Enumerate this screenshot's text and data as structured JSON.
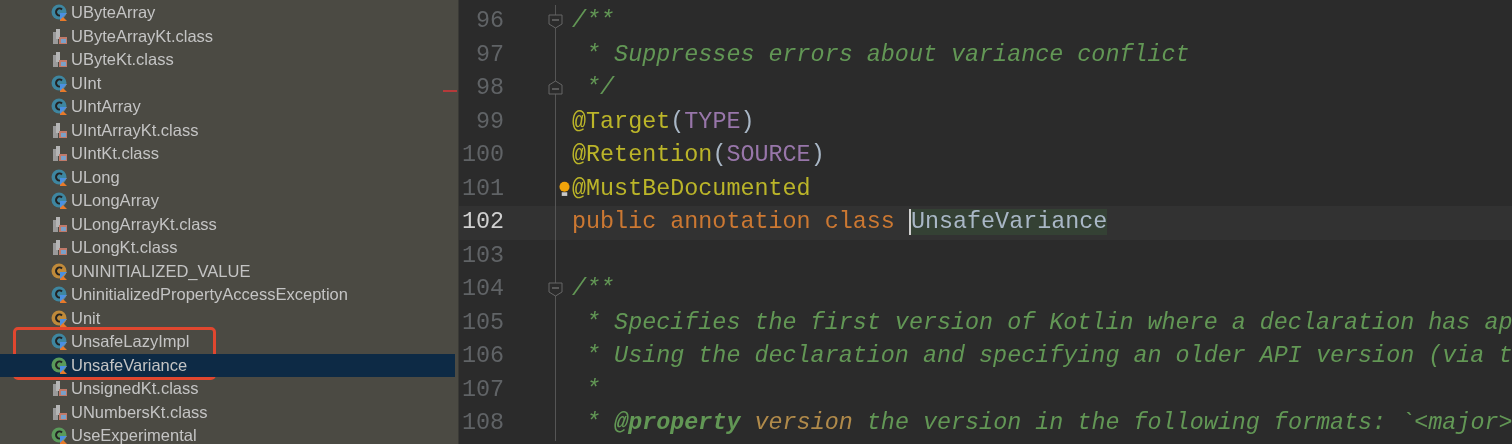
{
  "project_tree": {
    "items": [
      {
        "label": "UByteArray",
        "kind": "class",
        "selected": false,
        "annotated": false
      },
      {
        "label": "UByteArrayKt.class",
        "kind": "file",
        "selected": false,
        "annotated": false
      },
      {
        "label": "UByteKt.class",
        "kind": "file",
        "selected": false,
        "annotated": false
      },
      {
        "label": "UInt",
        "kind": "class",
        "selected": false,
        "annotated": false
      },
      {
        "label": "UIntArray",
        "kind": "class",
        "selected": false,
        "annotated": false
      },
      {
        "label": "UIntArrayKt.class",
        "kind": "file",
        "selected": false,
        "annotated": false
      },
      {
        "label": "UIntKt.class",
        "kind": "file",
        "selected": false,
        "annotated": false
      },
      {
        "label": "ULong",
        "kind": "class",
        "selected": false,
        "annotated": false
      },
      {
        "label": "ULongArray",
        "kind": "class",
        "selected": false,
        "annotated": false
      },
      {
        "label": "ULongArrayKt.class",
        "kind": "file",
        "selected": false,
        "annotated": false
      },
      {
        "label": "ULongKt.class",
        "kind": "file",
        "selected": false,
        "annotated": false
      },
      {
        "label": "UNINITIALIZED_VALUE",
        "kind": "object",
        "selected": false,
        "annotated": false
      },
      {
        "label": "UninitializedPropertyAccessException",
        "kind": "class",
        "selected": false,
        "annotated": false
      },
      {
        "label": "Unit",
        "kind": "object",
        "selected": false,
        "annotated": false
      },
      {
        "label": "UnsafeLazyImpl",
        "kind": "class",
        "selected": false,
        "annotated": true
      },
      {
        "label": "UnsafeVariance",
        "kind": "annotation",
        "selected": true,
        "annotated": true
      },
      {
        "label": "UnsignedKt.class",
        "kind": "file",
        "selected": false,
        "annotated": false
      },
      {
        "label": "UNumbersKt.class",
        "kind": "file",
        "selected": false,
        "annotated": false
      },
      {
        "label": "UseExperimental",
        "kind": "annotation",
        "selected": false,
        "annotated": false
      }
    ]
  },
  "editor": {
    "lines": [
      {
        "number": "96",
        "current": false,
        "kind": "fold_open",
        "segments": [
          {
            "kind": "comment",
            "text": "/**"
          }
        ]
      },
      {
        "number": "97",
        "current": false,
        "kind": "code",
        "segments": [
          {
            "kind": "comment",
            "text": " * Suppresses errors about variance conflict"
          }
        ]
      },
      {
        "number": "98",
        "current": false,
        "kind": "fold_close",
        "segments": [
          {
            "kind": "comment",
            "text": " */"
          }
        ]
      },
      {
        "number": "99",
        "current": false,
        "kind": "code",
        "segments": [
          {
            "kind": "annotation",
            "text": "@Target"
          },
          {
            "kind": "punct",
            "text": "("
          },
          {
            "kind": "constant",
            "text": "TYPE"
          },
          {
            "kind": "punct",
            "text": ")"
          }
        ]
      },
      {
        "number": "100",
        "current": false,
        "kind": "code",
        "segments": [
          {
            "kind": "annotation",
            "text": "@Retention"
          },
          {
            "kind": "punct",
            "text": "("
          },
          {
            "kind": "constant",
            "text": "SOURCE"
          },
          {
            "kind": "punct",
            "text": ")"
          }
        ]
      },
      {
        "number": "101",
        "current": false,
        "kind": "code",
        "bulb": true,
        "segments": [
          {
            "kind": "annotation",
            "text": "@MustBeDocumented"
          }
        ]
      },
      {
        "number": "102",
        "current": true,
        "kind": "code",
        "segments": [
          {
            "kind": "keyword",
            "text": "public annotation class "
          },
          {
            "kind": "identifier",
            "text": "UnsafeVariance",
            "highlighted": true,
            "caret": true
          }
        ]
      },
      {
        "number": "103",
        "current": false,
        "kind": "code"
      },
      {
        "number": "104",
        "current": false,
        "kind": "fold_open",
        "segments": [
          {
            "kind": "comment",
            "text": "/**"
          }
        ]
      },
      {
        "number": "105",
        "current": false,
        "kind": "code",
        "segments": [
          {
            "kind": "comment",
            "text": " * Specifies the first version of Kotlin where a declaration has ap"
          }
        ]
      },
      {
        "number": "106",
        "current": false,
        "kind": "code",
        "segments": [
          {
            "kind": "comment",
            "text": " * Using the declaration and specifying an older API version (via t"
          }
        ]
      },
      {
        "number": "107",
        "current": false,
        "kind": "code",
        "segments": [
          {
            "kind": "comment",
            "text": " *"
          }
        ]
      },
      {
        "number": "108",
        "current": false,
        "kind": "code",
        "segments": [
          {
            "kind": "comment",
            "text": " * "
          },
          {
            "kind": "doc-tag",
            "text": "@property"
          },
          {
            "kind": "doc-param",
            "text": " version"
          },
          {
            "kind": "comment",
            "text": " the version in the following formats: `<major>"
          }
        ]
      }
    ]
  }
}
